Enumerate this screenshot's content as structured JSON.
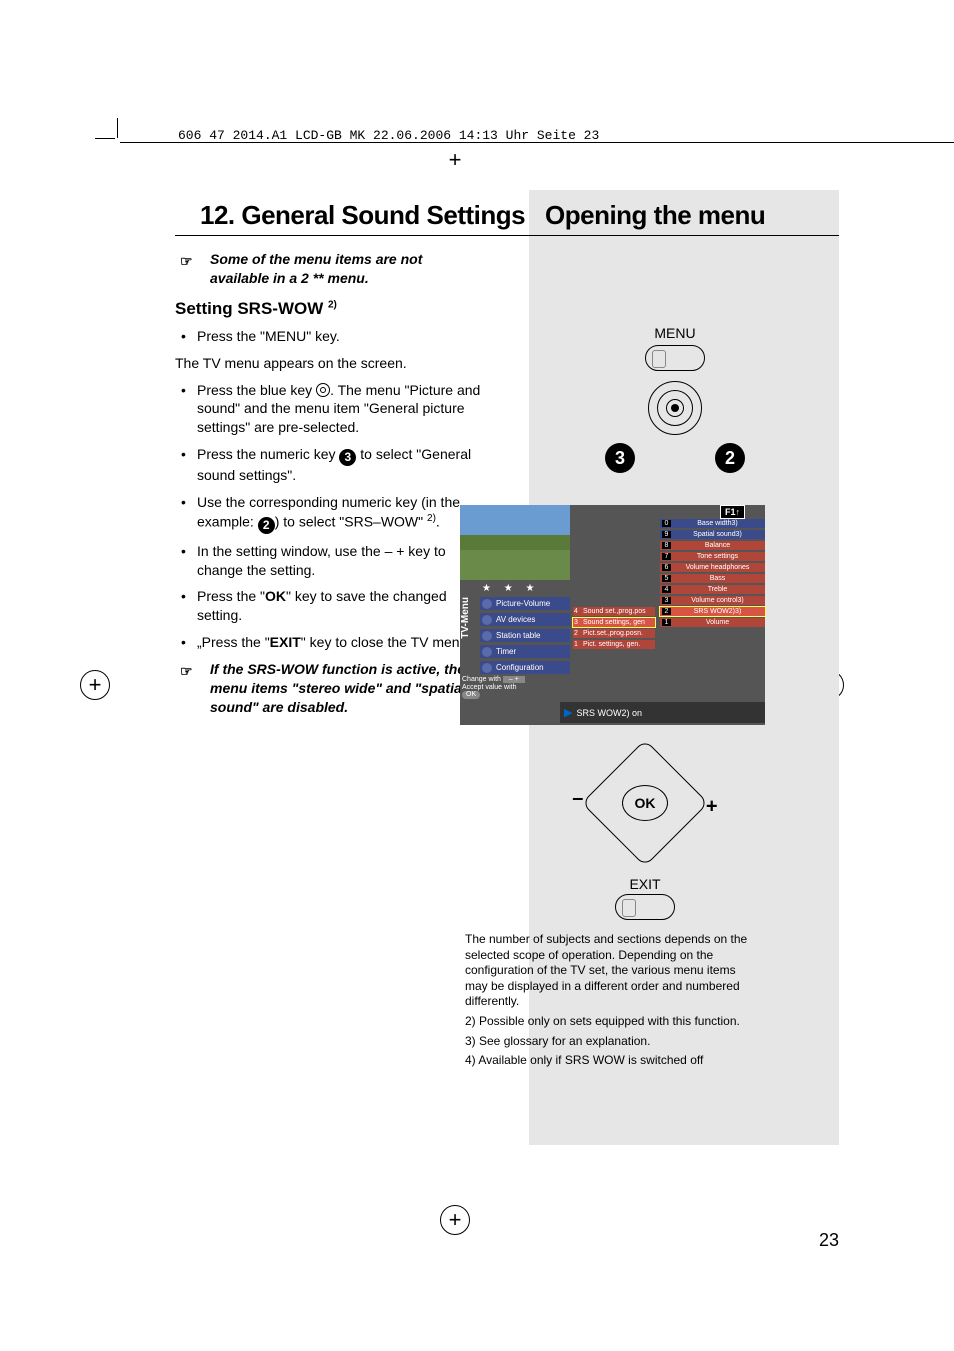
{
  "headerInfo": "606 47 2014.A1 LCD-GB MK  22.06.2006  14:13 Uhr  Seite 23",
  "titleLeft": "12. General Sound Settings",
  "titleRight": "Opening the menu",
  "note1": "Some of the menu items are not available in a 2 ** menu.",
  "subhead": "Setting SRS-WOW",
  "subheadSup": "2)",
  "bullets": {
    "b1": "Press the \"MENU\" key.",
    "para1": "The TV menu appears on the screen.",
    "b2a": "Press the blue key ",
    "b2b": ". The menu \"Picture and sound\" and the menu item \"General picture settings\" are pre-selected.",
    "b3a": "Press the numeric key ",
    "b3b": " to select \"General sound settings\".",
    "b3num": "3",
    "b4a": "Use the corresponding numeric key (in the example: ",
    "b4b": ") to select \"SRS–WOW\" ",
    "b4sup": "2)",
    "b4c": ".",
    "b4num": "2",
    "b5": "In the setting window, use the – + key to change the setting.",
    "b6a": "Press the \"",
    "b6ok": "OK",
    "b6b": "\" key to save the changed setting.",
    "b7a": "„Press the \"",
    "b7exit": "EXIT",
    "b7b": "\" key to close the TV menu."
  },
  "note2": "If the SRS-WOW function is active, the menu items \"stereo wide\" and \"spatial sound\" are disabled.",
  "remote": {
    "menuLabel": "MENU",
    "d3": "3",
    "d2": "2",
    "okLabel": "OK",
    "exitLabel": "EXIT"
  },
  "osd": {
    "vertLabel": "TV-Menu",
    "stars": "★ ★ ★",
    "f1": "F1↑",
    "left": [
      "Picture-Volume",
      "AV devices",
      "Station table",
      "Timer",
      "Configuration"
    ],
    "mid": [
      {
        "n": "4",
        "t": "Sound set.,prog.pos"
      },
      {
        "n": "3",
        "t": "Sound settings, gen"
      },
      {
        "n": "2",
        "t": "Pict.set.,prog.posn."
      },
      {
        "n": "1",
        "t": "Pict. settings, gen."
      }
    ],
    "midSelIdx": 1,
    "right": [
      {
        "n": "0",
        "t": "Base width3)"
      },
      {
        "n": "9",
        "t": "Spatial sound3)"
      },
      {
        "n": "8",
        "t": "Balance"
      },
      {
        "n": "7",
        "t": "Tone settings"
      },
      {
        "n": "6",
        "t": "Volume headphones"
      },
      {
        "n": "5",
        "t": "Bass"
      },
      {
        "n": "4",
        "t": "Treble"
      },
      {
        "n": "3",
        "t": "Volume control3)"
      },
      {
        "n": "2",
        "t": "SRS WOW2)3)"
      },
      {
        "n": "1",
        "t": "Volume"
      }
    ],
    "rightSelIdx": 8,
    "hint1": "Change with",
    "hint2": "Accept value with",
    "hint3": "OK",
    "sub": "SRS WOW2)    on"
  },
  "footnotes": {
    "p1": "The number of subjects and sections depends on the selected scope of operation. Depending on the configuration of the TV set, the various menu items may be displayed in a different order and numbered differently.",
    "p2": "2) Possible only on sets equipped with this function.",
    "p3": "3) See glossary for an explanation.",
    "p4": "4) Available only if SRS WOW is switched off"
  },
  "pageNo": "23"
}
